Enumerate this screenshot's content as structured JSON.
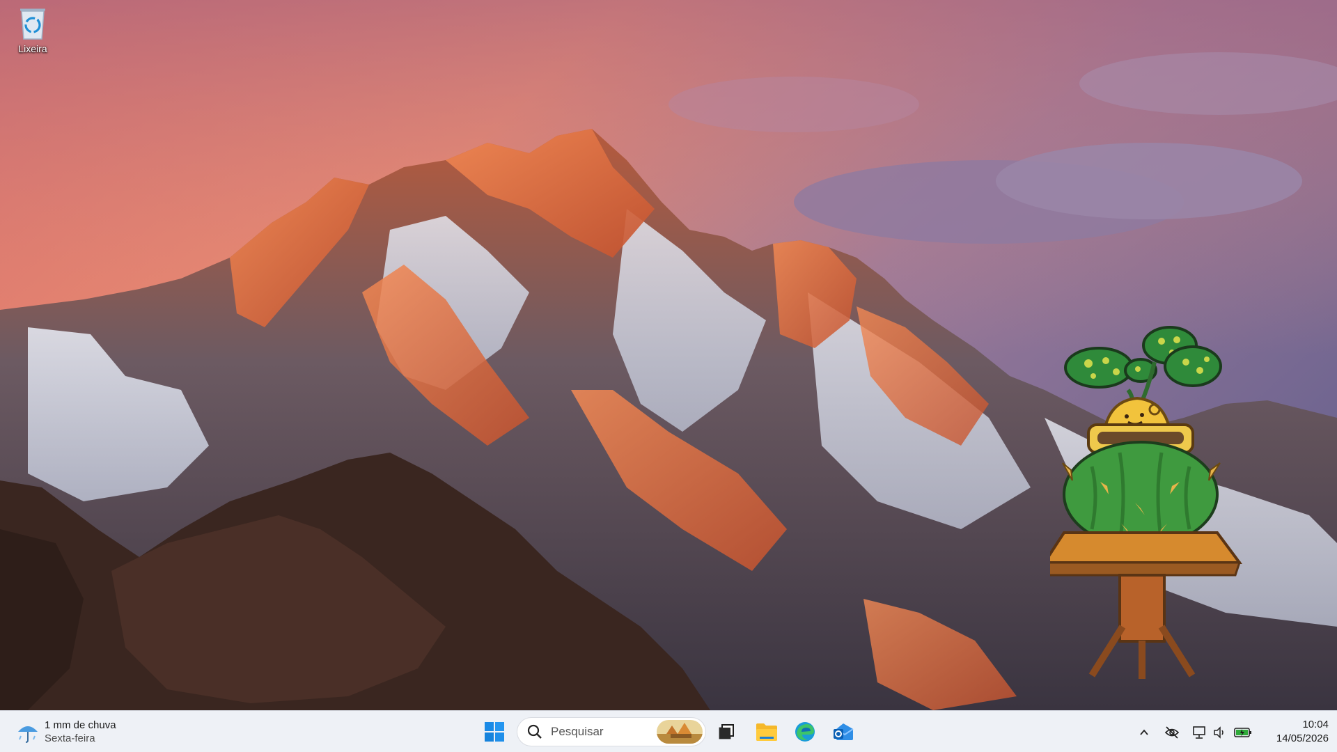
{
  "desktop": {
    "icons": [
      {
        "label": "Lixeira",
        "icon": "recycle-bin-icon"
      }
    ]
  },
  "taskbar": {
    "weather": {
      "line1": "1 mm de chuva",
      "line2": "Sexta-feira",
      "icon": "rain-umbrella-icon"
    },
    "start": {
      "icon": "windows-start-icon"
    },
    "search": {
      "placeholder": "Pesquisar",
      "icon": "search-icon"
    },
    "pinned": [
      {
        "name": "Visão de tarefas",
        "icon": "task-view-icon"
      },
      {
        "name": "Explorador de Arquivos",
        "icon": "file-explorer-icon"
      },
      {
        "name": "Microsoft Edge",
        "icon": "edge-icon"
      },
      {
        "name": "Outlook",
        "icon": "outlook-icon"
      }
    ],
    "tray": [
      "chevron-up-icon",
      "hidden-eye-icon",
      "network-icon",
      "volume-icon",
      "battery-icon"
    ],
    "clock": {
      "time": "10:04",
      "date": "14/05/2026"
    }
  },
  "colors": {
    "taskbar_bg": "#eef1f6",
    "accent": "#0078d4"
  }
}
